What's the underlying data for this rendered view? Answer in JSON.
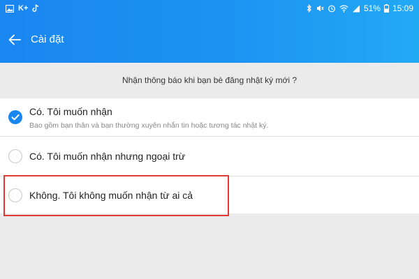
{
  "status_bar": {
    "carrier_label": "K+",
    "battery_percent": "51%",
    "time": "15:09"
  },
  "header": {
    "title": "Cài đặt"
  },
  "question": "Nhận thông báo khi bạn bè đăng nhật ký mới ?",
  "options": [
    {
      "label": "Có. Tôi muốn nhận",
      "sub": "Bao gồm bạn thân và bạn thường xuyên nhắn tin hoặc tương tác nhật ký.",
      "selected": true
    },
    {
      "label": "Có. Tôi muốn nhận nhưng ngoại trừ",
      "selected": false
    },
    {
      "label": "Không. Tôi không muốn nhận từ ai cả",
      "selected": false
    }
  ],
  "colors": {
    "accent": "#1a86f0",
    "header_gradient_end": "#22a9f4",
    "highlight": "#e53935",
    "background": "#ebebeb"
  },
  "icons": {
    "back": "arrow-left-icon",
    "check": "checkmark-icon"
  }
}
